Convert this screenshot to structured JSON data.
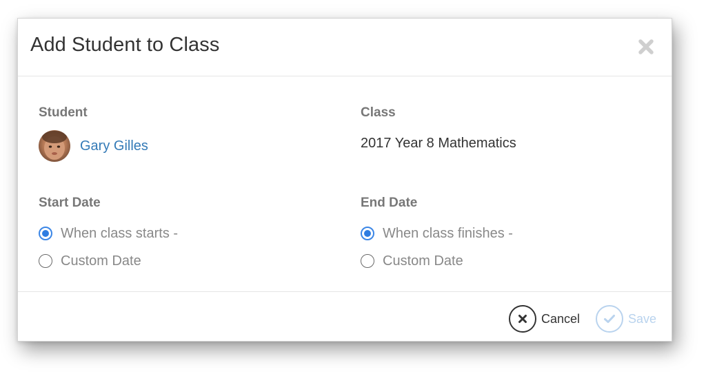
{
  "dialog": {
    "title": "Add Student to Class",
    "close_icon": "close-x-icon"
  },
  "student": {
    "label": "Student",
    "name": "Gary Gilles",
    "avatar_icon": "student-avatar-photo"
  },
  "class": {
    "label": "Class",
    "value": "2017 Year 8 Mathematics"
  },
  "start_date": {
    "label": "Start Date",
    "options": [
      {
        "label": "When class starts -",
        "checked": true
      },
      {
        "label": "Custom Date",
        "checked": false
      }
    ]
  },
  "end_date": {
    "label": "End Date",
    "options": [
      {
        "label": "When class finishes -",
        "checked": true
      },
      {
        "label": "Custom Date",
        "checked": false
      }
    ]
  },
  "footer": {
    "cancel_label": "Cancel",
    "cancel_icon": "x-circle-icon",
    "save_label": "Save",
    "save_icon": "check-circle-icon",
    "save_enabled": false
  },
  "colors": {
    "link": "#337ab7",
    "radio_selected": "#2f7de1",
    "save_disabled": "#b9d3ee",
    "label_gray": "#777777"
  }
}
